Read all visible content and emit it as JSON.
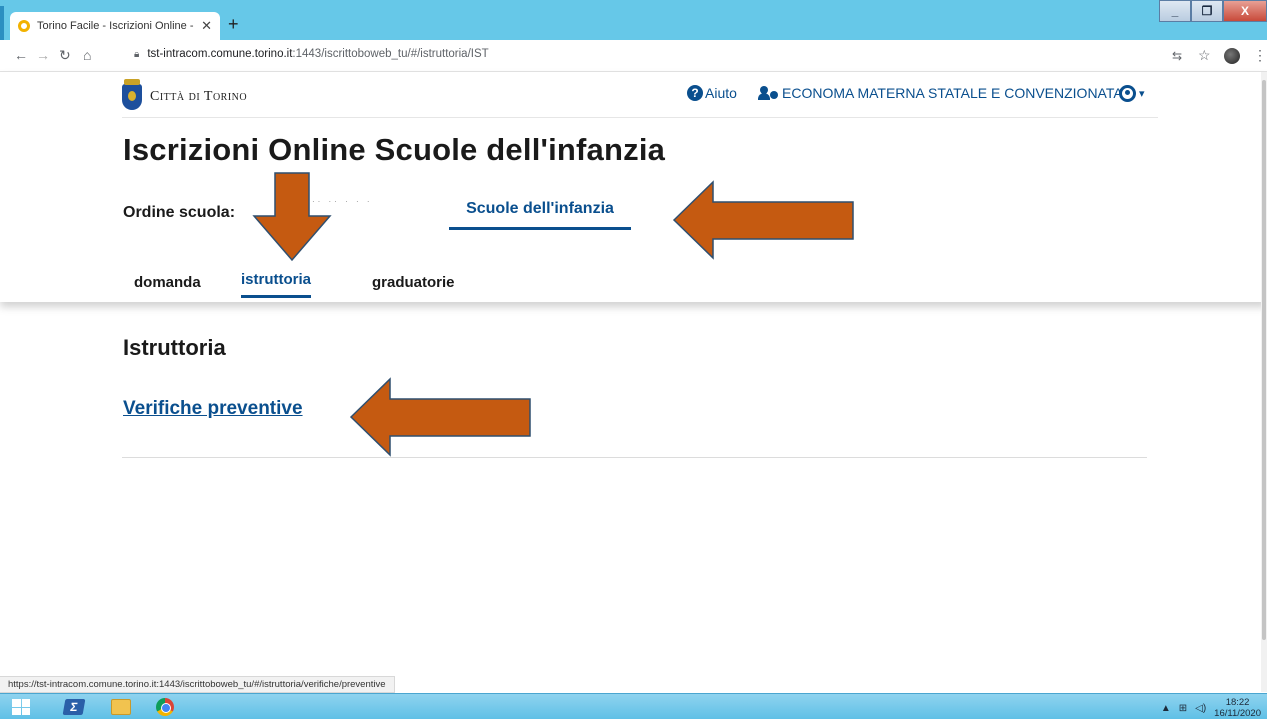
{
  "browser": {
    "tab_title": "Torino Facile - Iscrizioni Online - ",
    "tab_close": "✕",
    "new_tab": "+",
    "url_host": "tst-intracom.comune.torino.it",
    "url_path": ":1443/iscrittoboweb_tu/#/istruttoria/IST",
    "win_minimize": "_",
    "win_maximize": "❐",
    "win_close": "X"
  },
  "header": {
    "logo_text": "Città di Torino",
    "help_label": "Aiuto",
    "help_glyph": "?",
    "role_label": "ECONOMA MATERNA STATALE E CONVENZIONATA",
    "caret": "▾"
  },
  "page": {
    "title": "Iscrizioni Online Scuole dell'infanzia",
    "ordine_label": "Ordine scuola:",
    "faded_option": "·· ·· · · ·",
    "ordine_tab": "Scuole dell'infanzia",
    "tabs": [
      {
        "label": "domanda"
      },
      {
        "label": "istruttoria"
      },
      {
        "label": "graduatorie"
      }
    ]
  },
  "main": {
    "section_title": "Istruttoria",
    "link": "Verifiche preventive"
  },
  "statusbar": {
    "url": "https://tst-intracom.comune.torino.it:1443/iscrittoboweb_tu/#/istruttoria/verifiche/preventive"
  },
  "taskbar": {
    "time": "18:22",
    "date": "16/11/2020",
    "ps_glyph": "Σ"
  },
  "colors": {
    "accent": "#0a4f8e",
    "annotation_arrow": "#c55a11",
    "tabbar": "#66c8e8"
  },
  "icons": [
    "back-icon",
    "forward-icon",
    "reload-icon",
    "home-icon",
    "lock-icon",
    "translate-icon",
    "star-icon",
    "menu-icon",
    "help-icon",
    "users-icon",
    "user-circle-icon",
    "windows-icon",
    "powershell-icon",
    "folder-icon",
    "chrome-icon"
  ]
}
